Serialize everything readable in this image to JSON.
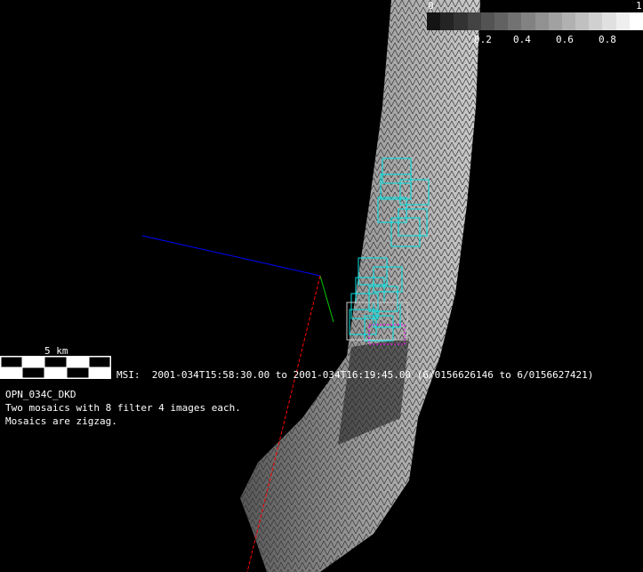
{
  "colorbar": {
    "min_label": "0",
    "max_label": "1",
    "ticks": [
      "0.2",
      "0.4",
      "0.6",
      "0.8"
    ],
    "steps": 16
  },
  "scale_bar": {
    "label": "5 km"
  },
  "msi_line": "MSI:  2001-034T15:58:30.00 to 2001-034T16:19:45.00 (6/0156626146 to 6/0156627421)",
  "info": {
    "title": "OPN_034C_DKD",
    "line1": "Two mosaics with 8 filter 4 images each.",
    "line2": "Mosaics are zigzag."
  },
  "colors": {
    "footprint": "#00e5e5",
    "axis_x": "#ff0000",
    "axis_y": "#00cc00",
    "axis_z": "#0000ff",
    "highlight": "#ff00ff"
  }
}
